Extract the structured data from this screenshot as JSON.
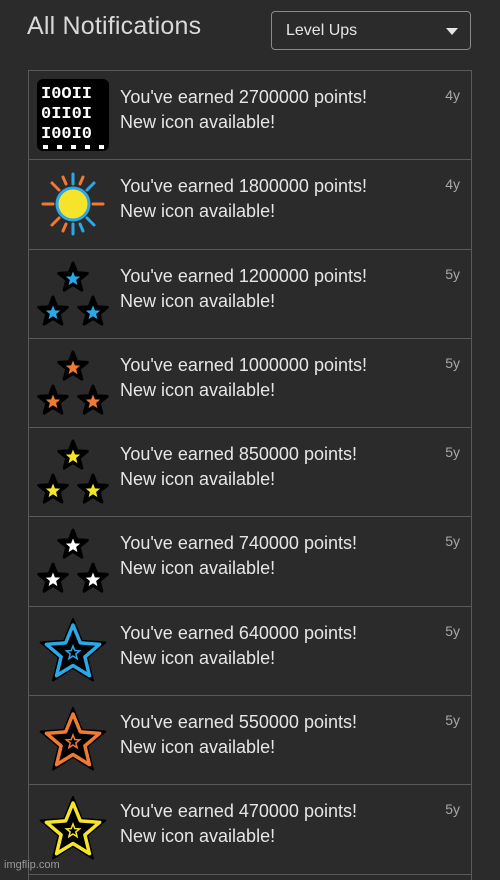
{
  "header": {
    "title": "All Notifications",
    "filter_value": "Level Ups"
  },
  "notifications": [
    {
      "line1": "You've earned 2700000 points!",
      "line2": "New icon available!",
      "age": "4y",
      "icon": "binary-icon"
    },
    {
      "line1": "You've earned 1800000 points!",
      "line2": "New icon available!",
      "age": "4y",
      "icon": "sun-icon"
    },
    {
      "line1": "You've earned 1200000 points!",
      "line2": "New icon available!",
      "age": "5y",
      "icon": "three-stars-blue-icon",
      "color": "#2aa8e8"
    },
    {
      "line1": "You've earned 1000000 points!",
      "line2": "New icon available!",
      "age": "5y",
      "icon": "three-stars-orange-icon",
      "color": "#f07a34"
    },
    {
      "line1": "You've earned 850000 points!",
      "line2": "New icon available!",
      "age": "5y",
      "icon": "three-stars-yellow-icon",
      "color": "#f5e42a"
    },
    {
      "line1": "You've earned 740000 points!",
      "line2": "New icon available!",
      "age": "5y",
      "icon": "three-stars-white-icon",
      "color": "#ffffff"
    },
    {
      "line1": "You've earned 640000 points!",
      "line2": "New icon available!",
      "age": "5y",
      "icon": "big-star-blue-icon",
      "color": "#2aa8e8"
    },
    {
      "line1": "You've earned 550000 points!",
      "line2": "New icon available!",
      "age": "5y",
      "icon": "big-star-orange-icon",
      "color": "#f07a34"
    },
    {
      "line1": "You've earned 470000 points!",
      "line2": "New icon available!",
      "age": "5y",
      "icon": "big-star-yellow-icon",
      "color": "#f5e42a"
    }
  ],
  "watermark": "imgflip.com"
}
